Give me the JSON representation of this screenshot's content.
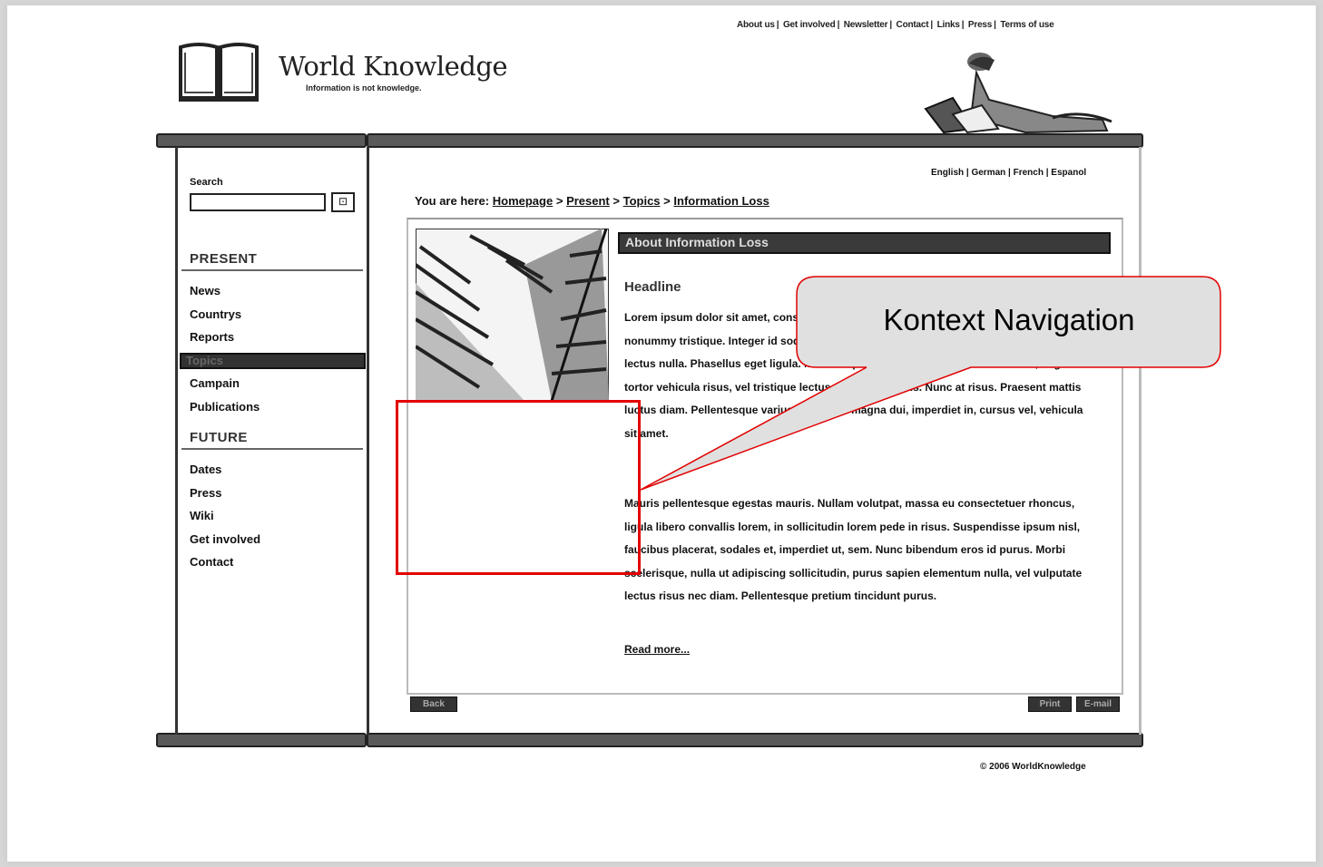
{
  "top_links": [
    "About us",
    "Get involved",
    "Newsletter",
    "Contact",
    "Links",
    "Press",
    "Terms of use"
  ],
  "logo": {
    "title": "World Knowledge",
    "tagline": "Information is not knowledge."
  },
  "sidebar": {
    "search_label": "Search",
    "search_value": "",
    "search_button": "⊡",
    "sections": [
      {
        "title": "PRESENT",
        "items": [
          "News",
          "Countrys",
          "Reports",
          "Topics",
          "Campain",
          "Publications"
        ],
        "active": "Topics"
      },
      {
        "title": "FUTURE",
        "items": [
          "Dates",
          "Press",
          "Wiki",
          "Get involved",
          "Contact"
        ]
      }
    ]
  },
  "languages": "English | German | French | Espanol",
  "breadcrumb": {
    "prefix": "You are here:",
    "items": [
      "Homepage",
      "Present",
      "Topics",
      "Information Loss"
    ],
    "separator": ">"
  },
  "content": {
    "header": "About Information Loss",
    "headline": "Headline",
    "paragraph1": "Lorem ipsum dolor sit amet, consectetuer adipiscing elit. Nunc sit amet augue id mi nonummy tristique. Integer id sodales auctor, lectus ligula vestibulum arcu, nec lacinia lectus nulla. Phasellus eget ligula. Morbi aliquam. Nullam et ante nec commodo, augue tortor vehicula risus, vel tristique lectus turpis nec purus. Nunc at risus. Praesent mattis luctus diam. Pellentesque varius. Curabitur magna dui, imperdiet in, cursus vel, vehicula sit amet.",
    "paragraph2": "Mauris pellentesque egestas mauris. Nullam volutpat, massa eu consectetuer rhoncus, ligula libero convallis lorem, in sollicitudin lorem pede in risus. Suspendisse ipsum nisl, faucibus placerat, sodales et, imperdiet ut, sem. Nunc bibendum eros id purus. Morbi scelerisque, nulla ut adipiscing sollicitudin, purus sapien elementum nulla, vel vulputate lectus risus nec diam. Pellentesque pretium tincidunt purus.",
    "read_more": "Read more...",
    "back_button": "Back",
    "print_button": "Print",
    "email_button": "E-mail"
  },
  "copyright": "© 2006 WorldKnowledge",
  "annotation": {
    "callout_text": "Kontext Navigation",
    "highlight_color": "#e20000"
  },
  "colors": {
    "bar": "#5a5a5a",
    "callout_fill": "#e0e0e0",
    "callout_stroke": "#e20000"
  }
}
